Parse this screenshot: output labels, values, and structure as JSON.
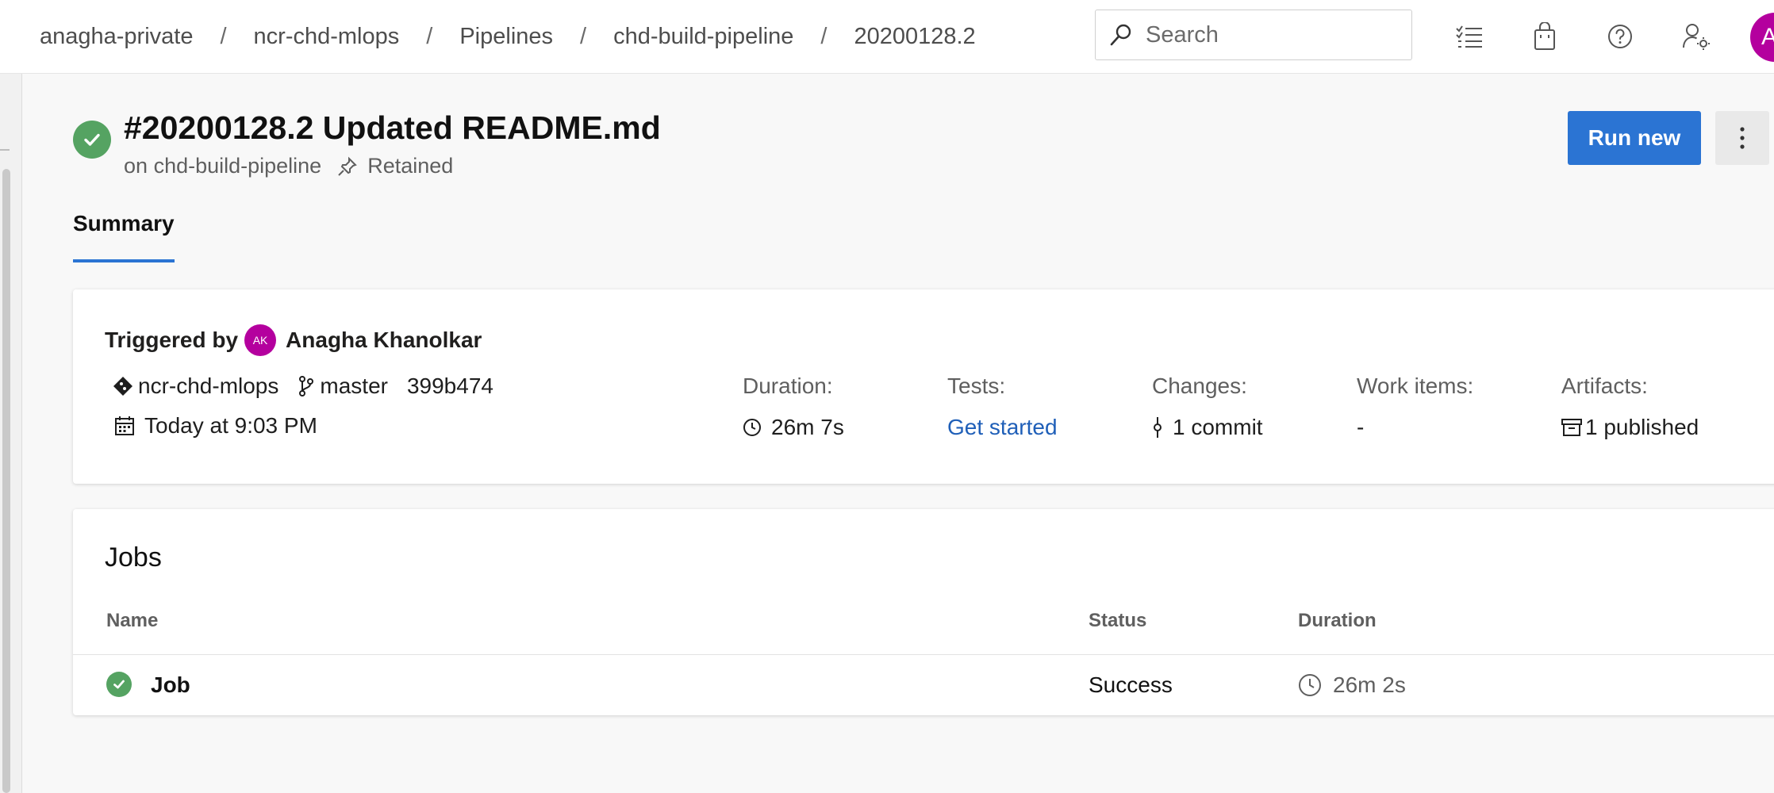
{
  "breadcrumb": {
    "items": [
      "anagha-private",
      "ncr-chd-mlops",
      "Pipelines",
      "chd-build-pipeline",
      "20200128.2"
    ],
    "separator": "/"
  },
  "search": {
    "placeholder": "Search"
  },
  "topbar_icons": [
    "work-items-list-icon",
    "marketplace-bag-icon",
    "help-icon",
    "user-settings-icon"
  ],
  "user_avatar": {
    "initial": "A",
    "color": "#b4009e"
  },
  "run": {
    "title": "#20200128.2 Updated README.md",
    "pipeline_prefix": "on",
    "pipeline": "chd-build-pipeline",
    "retained_label": "Retained",
    "status": "succeeded",
    "status_color": "#55a362"
  },
  "actions": {
    "run_new": "Run new"
  },
  "tabs": [
    {
      "label": "Summary",
      "active": true
    }
  ],
  "summary": {
    "triggered_by_label": "Triggered by",
    "triggered_by_initials": "AK",
    "triggered_by_name": "Anagha Khanolkar",
    "repo": "ncr-chd-mlops",
    "branch": "master",
    "commit": "399b474",
    "date": "Today at 9:03 PM",
    "stats": {
      "duration": {
        "label": "Duration:",
        "value": "26m 7s"
      },
      "tests": {
        "label": "Tests:",
        "value": "Get started"
      },
      "changes": {
        "label": "Changes:",
        "value": "1 commit"
      },
      "work_items": {
        "label": "Work items:",
        "value": "-"
      },
      "artifacts": {
        "label": "Artifacts:",
        "value": "1 published"
      }
    }
  },
  "jobs": {
    "title": "Jobs",
    "columns": [
      "Name",
      "Status",
      "Duration"
    ],
    "rows": [
      {
        "name": "Job",
        "status": "Success",
        "duration": "26m 2s"
      }
    ]
  },
  "colors": {
    "accent": "#2b74d3",
    "success": "#55a362",
    "link": "#1f5fb8"
  }
}
